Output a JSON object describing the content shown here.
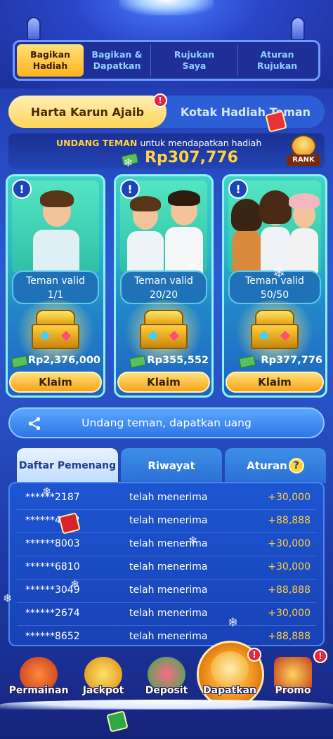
{
  "top_tabs": [
    {
      "label": "Bagikan Hadiah",
      "active": true
    },
    {
      "label": "Bagikan & Dapatkan",
      "active": false
    },
    {
      "label": "Rujukan Saya",
      "active": false
    },
    {
      "label": "Aturan Rujukan",
      "active": false
    }
  ],
  "mode_switch": {
    "left": "Harta Karun Ajaib",
    "right": "Kotak Hadiah Teman",
    "alert_symbol": "!"
  },
  "invite": {
    "highlight": "UNDANG TEMAN",
    "text": " untuk mendapatkan hadiah",
    "total": "Rp307,776",
    "rank_label": "RANK"
  },
  "cards": [
    {
      "label": "Teman valid",
      "progress": "1/1",
      "amount": "Rp2,376,000",
      "button": "Klaim",
      "info": "!"
    },
    {
      "label": "Teman valid",
      "progress": "20/20",
      "amount": "Rp355,552",
      "button": "Klaim",
      "info": "!"
    },
    {
      "label": "Teman valid",
      "progress": "50/50",
      "amount": "Rp377,776",
      "button": "Klaim",
      "info": "!"
    }
  ],
  "share": {
    "label": "Undang teman, dapatkan uang",
    "icon": "share-icon"
  },
  "list_tabs": [
    {
      "label": "Daftar Pemenang",
      "active": true
    },
    {
      "label": "Riwayat",
      "active": false
    },
    {
      "label": "Aturan",
      "active": false,
      "icon": "?"
    }
  ],
  "winners": [
    {
      "user": "******2187",
      "status": "telah menerima",
      "amount": "+30,000"
    },
    {
      "user": "******4932",
      "status": "telah menerima",
      "amount": "+88,888"
    },
    {
      "user": "******8003",
      "status": "telah menerima",
      "amount": "+30,000"
    },
    {
      "user": "******6810",
      "status": "telah menerima",
      "amount": "+30,000"
    },
    {
      "user": "******3049",
      "status": "telah menerima",
      "amount": "+88,888"
    },
    {
      "user": "******2674",
      "status": "telah menerima",
      "amount": "+30,000"
    },
    {
      "user": "******8652",
      "status": "telah menerima",
      "amount": "+88,888"
    }
  ],
  "bottom_nav": [
    {
      "label": "Permainan",
      "icon": "slot-machine-icon",
      "active": false
    },
    {
      "label": "Jackpot",
      "icon": "trophy-icon",
      "active": false
    },
    {
      "label": "Deposit",
      "icon": "gift-basket-icon",
      "active": false
    },
    {
      "label": "Dapatkan",
      "icon": "reward-wheel-icon",
      "active": true
    },
    {
      "label": "Promo",
      "icon": "treasure-chest-icon",
      "active": false
    }
  ],
  "colors": {
    "accent_gold": "#ffd23f",
    "primary_blue": "#2a5ed3",
    "alert_red": "#e8233a"
  }
}
